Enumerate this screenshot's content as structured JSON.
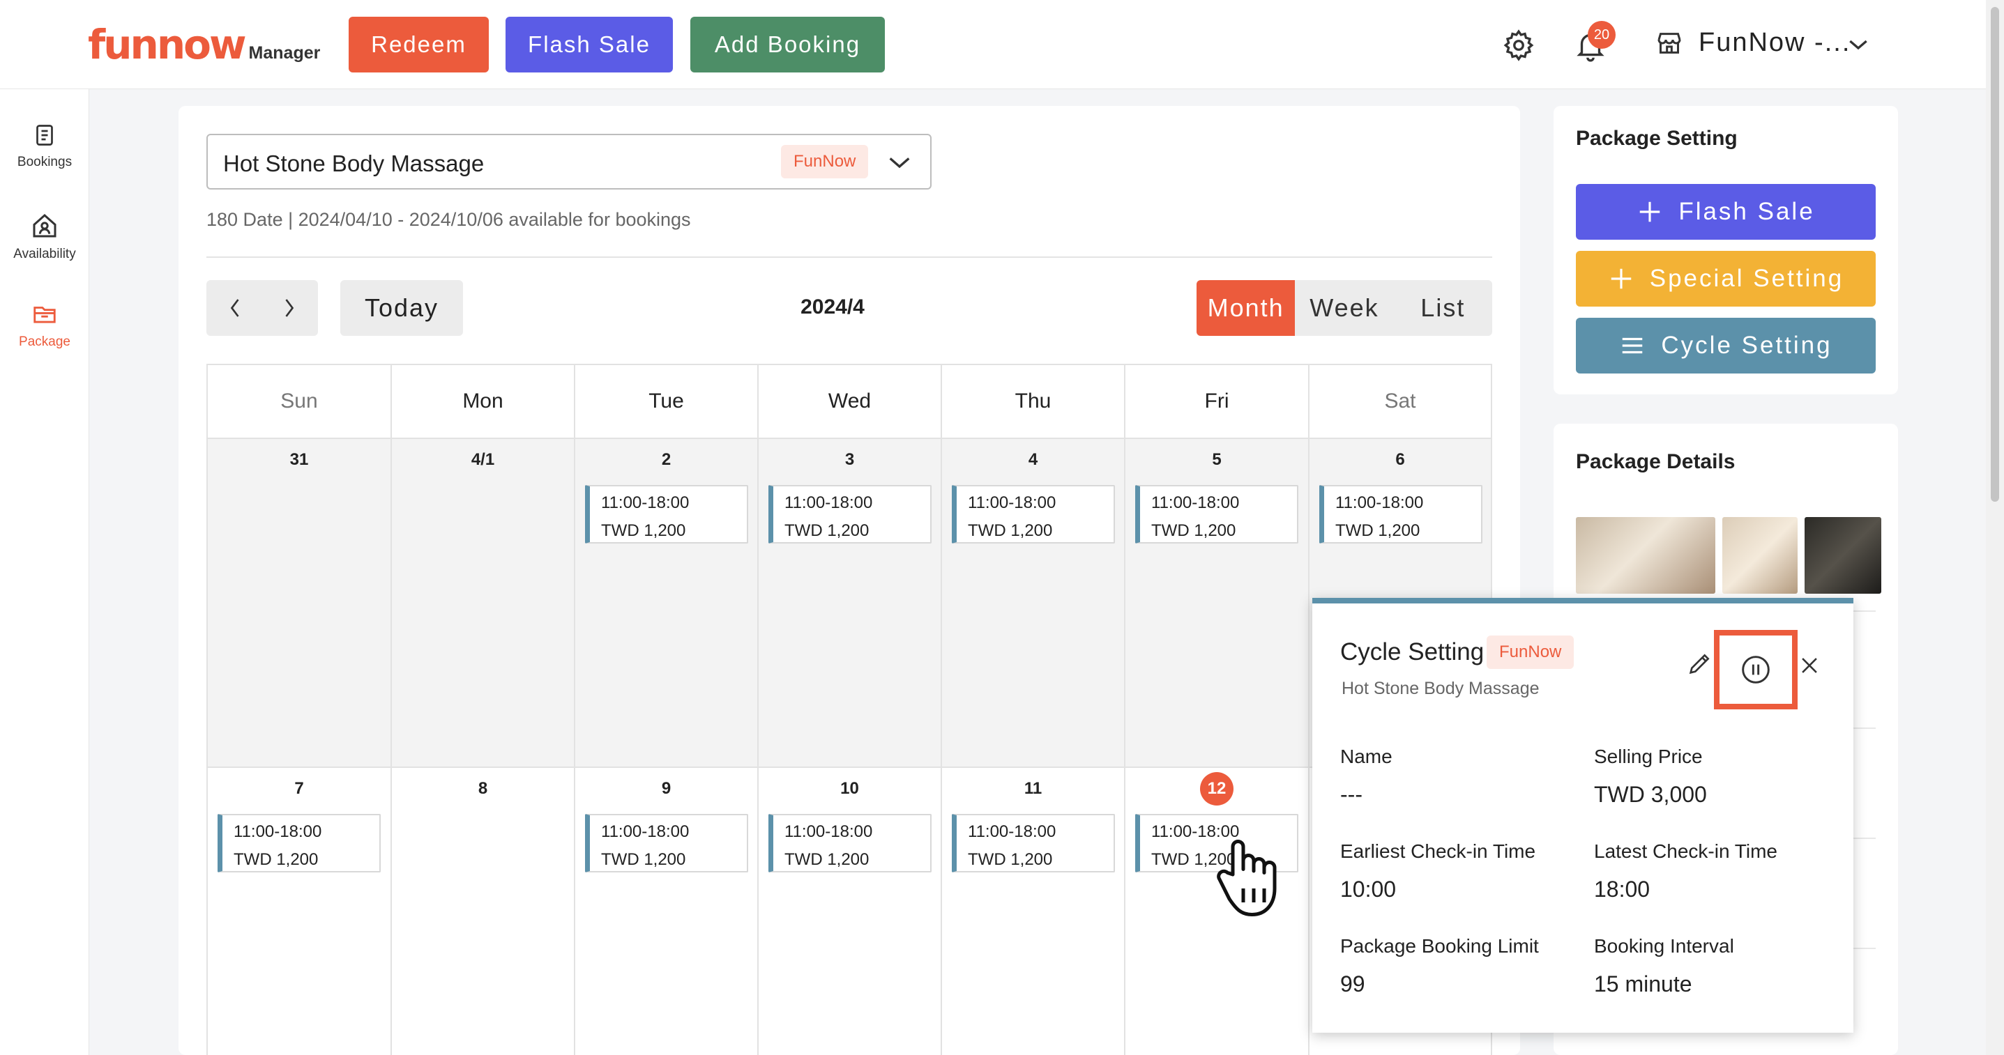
{
  "header": {
    "logo": "funnow",
    "logo_sub": "Manager",
    "redeem": "Redeem",
    "flash_sale": "Flash Sale",
    "add_booking": "Add Booking",
    "notification_count": "20",
    "store_name": "FunNow -..."
  },
  "sidenav": {
    "bookings": "Bookings",
    "availability": "Availability",
    "package": "Package"
  },
  "calendar": {
    "package_name": "Hot Stone Body Massage",
    "tag": "FunNow",
    "availability_text": "180 Date | 2024/04/10 - 2024/10/06 available for bookings",
    "today": "Today",
    "month_title": "2024/4",
    "views": {
      "month": "Month",
      "week": "Week",
      "list": "List"
    },
    "day_headers": [
      "Sun",
      "Mon",
      "Tue",
      "Wed",
      "Thu",
      "Fri",
      "Sat"
    ],
    "week1": {
      "dates": [
        "31",
        "4/1",
        "2",
        "3",
        "4",
        "5",
        "6"
      ],
      "events": [
        {
          "time": "11:00-18:00",
          "price": "TWD 1,200"
        },
        {
          "time": "11:00-18:00",
          "price": "TWD 1,200"
        },
        {
          "time": "11:00-18:00",
          "price": "TWD 1,200"
        },
        {
          "time": "11:00-18:00",
          "price": "TWD 1,200"
        },
        {
          "time": "11:00-18:00",
          "price": "TWD 1,200"
        }
      ]
    },
    "week2": {
      "dates": [
        "7",
        "8",
        "9",
        "10",
        "11",
        "12"
      ],
      "events": [
        {
          "time": "11:00-18:00",
          "price": "TWD 1,200"
        },
        {
          "time": "11:00-18:00",
          "price": "TWD 1,200"
        },
        {
          "time": "11:00-18:00",
          "price": "TWD 1,200"
        },
        {
          "time": "11:00-18:00",
          "price": "TWD 1,200"
        },
        {
          "time": "11:00-18:00",
          "price": "TWD 1,200"
        }
      ]
    }
  },
  "package_setting": {
    "title": "Package Setting",
    "flash_sale": "Flash Sale",
    "special_setting": "Special Setting",
    "cycle_setting": "Cycle Setting"
  },
  "package_details": {
    "title": "Package Details"
  },
  "popover": {
    "title": "Cycle Setting",
    "tag": "FunNow",
    "subtitle": "Hot Stone Body Massage",
    "name_label": "Name",
    "name_value": "---",
    "selling_price_label": "Selling Price",
    "selling_price_value": "TWD 3,000",
    "earliest_label": "Earliest Check-in Time",
    "earliest_value": "10:00",
    "latest_label": "Latest Check-in Time",
    "latest_value": "18:00",
    "limit_label": "Package Booking Limit",
    "limit_value": "99",
    "interval_label": "Booking Interval",
    "interval_value": "15 minute"
  },
  "colors": {
    "brand": "#ec5b3c",
    "flash": "#5b5ce6",
    "add_booking": "#4d8e67",
    "special": "#f3b235",
    "cycle": "#5c91aa"
  }
}
